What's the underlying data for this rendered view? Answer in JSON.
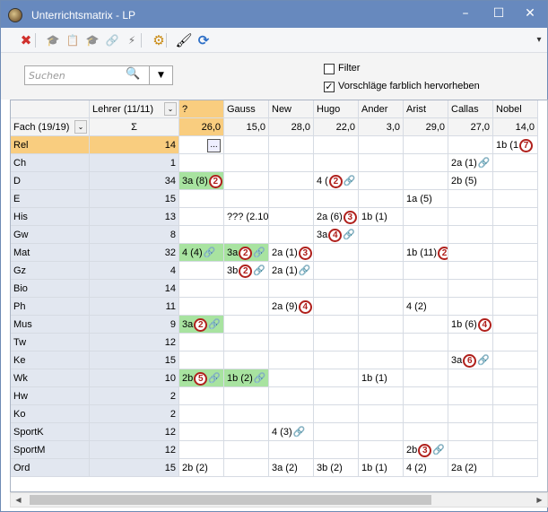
{
  "window": {
    "title": "Unterrichtsmatrix - LP",
    "controls": {
      "minimize": "–",
      "maximize": "☐",
      "close": "✕"
    },
    "pin": "▾"
  },
  "toolbar": {
    "icons": [
      "delete-icon",
      "teacher-hat-icon",
      "report-icon",
      "teacher-hat-settings-icon",
      "link-icon",
      "fix-icon",
      "gear-icon",
      "brush-icon",
      "refresh-icon"
    ],
    "glyphs": [
      "✖",
      "🎓",
      "📋",
      "🎓",
      "🔗",
      "⚡",
      "⚙",
      "🖌",
      "⟳"
    ]
  },
  "filter": {
    "search_placeholder": "Suchen",
    "dropdown": "▼",
    "filter_label": "Filter",
    "filter_checked": false,
    "highlight_label": "Vorschläge farblich hervorheben",
    "highlight_checked": true
  },
  "grid": {
    "teacher_header": "Lehrer (11/11)",
    "subject_header": "Fach (19/19)",
    "sigma": "Σ",
    "teachers": [
      {
        "name": "?",
        "sum": "26,0"
      },
      {
        "name": "Gauss",
        "sum": "15,0"
      },
      {
        "name": "New",
        "sum": "28,0"
      },
      {
        "name": "Hugo",
        "sum": "22,0"
      },
      {
        "name": "Ander",
        "sum": "3,0"
      },
      {
        "name": "Arist",
        "sum": "29,0"
      },
      {
        "name": "Callas",
        "sum": "27,0"
      },
      {
        "name": "Nobel",
        "sum": "14,0"
      }
    ],
    "rows": [
      {
        "subject": "Rel",
        "total": "14",
        "selected": true,
        "cells": [
          {
            "text": "",
            "ellipsis": "..."
          },
          null,
          null,
          null,
          null,
          null,
          null,
          {
            "text": "1b (1",
            "circ": "7"
          }
        ]
      },
      {
        "subject": "Ch",
        "total": "1",
        "cells": [
          null,
          null,
          null,
          null,
          null,
          null,
          {
            "text": "2a (1)",
            "link": true
          },
          null
        ]
      },
      {
        "subject": "D",
        "total": "34",
        "cells": [
          {
            "text": "3a (8)",
            "circ": "2",
            "green": true
          },
          null,
          null,
          {
            "text": "4 (",
            "circ": "2",
            "link": true
          },
          null,
          null,
          {
            "text": "2b (5)"
          },
          null
        ]
      },
      {
        "subject": "E",
        "total": "15",
        "cells": [
          null,
          null,
          null,
          null,
          null,
          {
            "text": "1a (5)"
          },
          null,
          null
        ]
      },
      {
        "subject": "His",
        "total": "13",
        "cells": [
          null,
          {
            "text": "??? (2.10"
          },
          null,
          {
            "text": "2a (6)",
            "circ": "3"
          },
          {
            "text": "1b (1)"
          },
          null,
          null,
          null
        ]
      },
      {
        "subject": "Gw",
        "total": "8",
        "cells": [
          null,
          null,
          null,
          {
            "text": "3a",
            "circ": "4",
            "link": true
          },
          null,
          null,
          null,
          null
        ]
      },
      {
        "subject": "Mat",
        "total": "32",
        "cells": [
          {
            "text": "4 (4)",
            "link": true,
            "green": true
          },
          {
            "text": "3a",
            "circ": "2",
            "link": true,
            "green": true
          },
          {
            "text": "2a (1)",
            "circ": "3"
          },
          null,
          null,
          {
            "text": "1b (11)",
            "circ": "2"
          },
          null,
          null
        ]
      },
      {
        "subject": "Gz",
        "total": "4",
        "cells": [
          null,
          {
            "text": "3b",
            "circ": "2",
            "link": true
          },
          {
            "text": "2a (1)",
            "link": true
          },
          null,
          null,
          null,
          null,
          null
        ]
      },
      {
        "subject": "Bio",
        "total": "14",
        "cells": [
          null,
          null,
          null,
          null,
          null,
          null,
          null,
          null
        ]
      },
      {
        "subject": "Ph",
        "total": "11",
        "cells": [
          null,
          null,
          {
            "text": "2a (9)",
            "circ": "4"
          },
          null,
          null,
          {
            "text": "4 (2)"
          },
          null,
          null
        ]
      },
      {
        "subject": "Mus",
        "total": "9",
        "cells": [
          {
            "text": "3a",
            "circ": "2",
            "link": true,
            "green": true
          },
          null,
          null,
          null,
          null,
          null,
          {
            "text": "1b (6)",
            "circ": "4"
          },
          null
        ]
      },
      {
        "subject": "Tw",
        "total": "12",
        "cells": [
          null,
          null,
          null,
          null,
          null,
          null,
          null,
          null
        ]
      },
      {
        "subject": "Ke",
        "total": "15",
        "cells": [
          null,
          null,
          null,
          null,
          null,
          null,
          {
            "text": "3a",
            "circ": "6",
            "link": true
          },
          null
        ]
      },
      {
        "subject": "Wk",
        "total": "10",
        "cells": [
          {
            "text": "2b",
            "circ": "5",
            "link": true,
            "green": true
          },
          {
            "text": "1b (2)",
            "link": true,
            "green": true
          },
          null,
          null,
          {
            "text": "1b (1)"
          },
          null,
          null,
          null
        ]
      },
      {
        "subject": "Hw",
        "total": "2",
        "cells": [
          null,
          null,
          null,
          null,
          null,
          null,
          null,
          null
        ]
      },
      {
        "subject": "Ko",
        "total": "2",
        "cells": [
          null,
          null,
          null,
          null,
          null,
          null,
          null,
          null
        ]
      },
      {
        "subject": "SportK",
        "total": "12",
        "cells": [
          null,
          null,
          {
            "text": "4 (3)",
            "link": true
          },
          null,
          null,
          null,
          null,
          null
        ]
      },
      {
        "subject": "SportM",
        "total": "12",
        "cells": [
          null,
          null,
          null,
          null,
          null,
          {
            "text": "2b",
            "circ": "3",
            "link": true
          },
          null,
          null
        ]
      },
      {
        "subject": "Ord",
        "total": "15",
        "cells": [
          {
            "text": "2b (2)"
          },
          null,
          {
            "text": "3a (2)"
          },
          {
            "text": "3b (2)"
          },
          {
            "text": "1b (1)"
          },
          {
            "text": "4 (2)"
          },
          {
            "text": "2a (2)"
          },
          null
        ]
      }
    ]
  },
  "scrollbar": {
    "left": "◀",
    "right": "▶"
  }
}
